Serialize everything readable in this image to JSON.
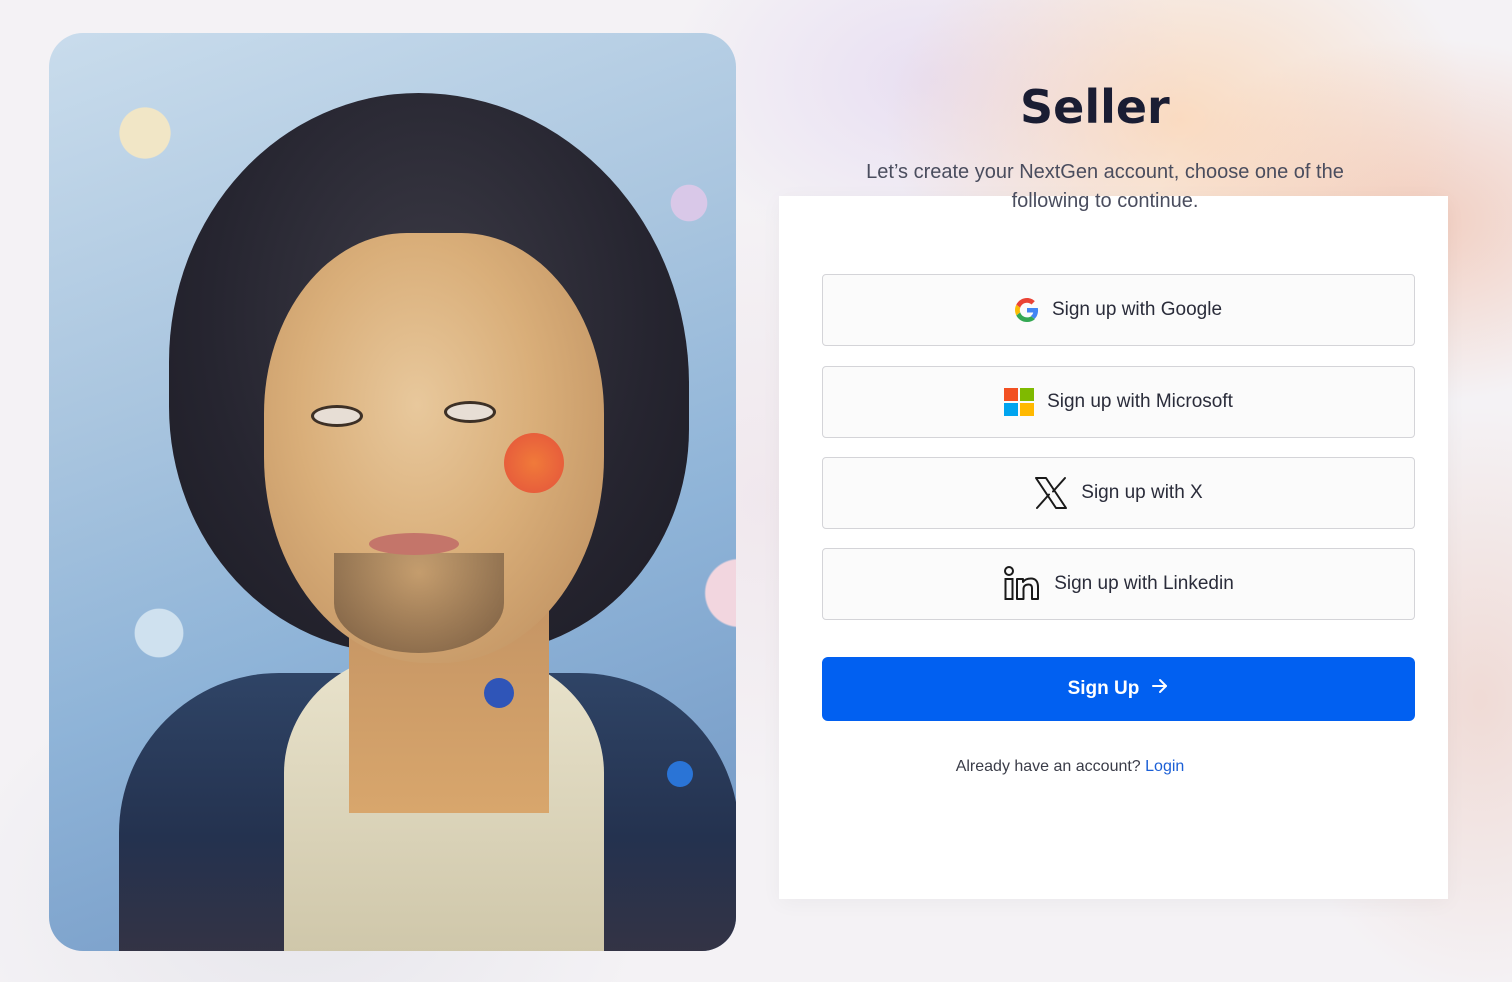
{
  "header": {
    "title": "Seller",
    "subtitle": "Let’s create your NextGen account, choose one of the following to continue."
  },
  "artwork": {
    "icon": "portrait-artwork"
  },
  "providers": [
    {
      "label": "Sign up with Google",
      "icon": "google-icon"
    },
    {
      "label": "Sign up with Microsoft",
      "icon": "microsoft-icon"
    },
    {
      "label": "Sign up with X",
      "icon": "x-icon"
    },
    {
      "label": "Sign up with Linkedin",
      "icon": "linkedin-icon"
    }
  ],
  "signup": {
    "label": "Sign Up",
    "icon": "arrow-right-icon"
  },
  "footer": {
    "prompt": "Already have an account?",
    "login_label": "Login"
  },
  "colors": {
    "primary": "#0160f1",
    "link": "#1b5fd6",
    "title": "#1a1d33"
  }
}
